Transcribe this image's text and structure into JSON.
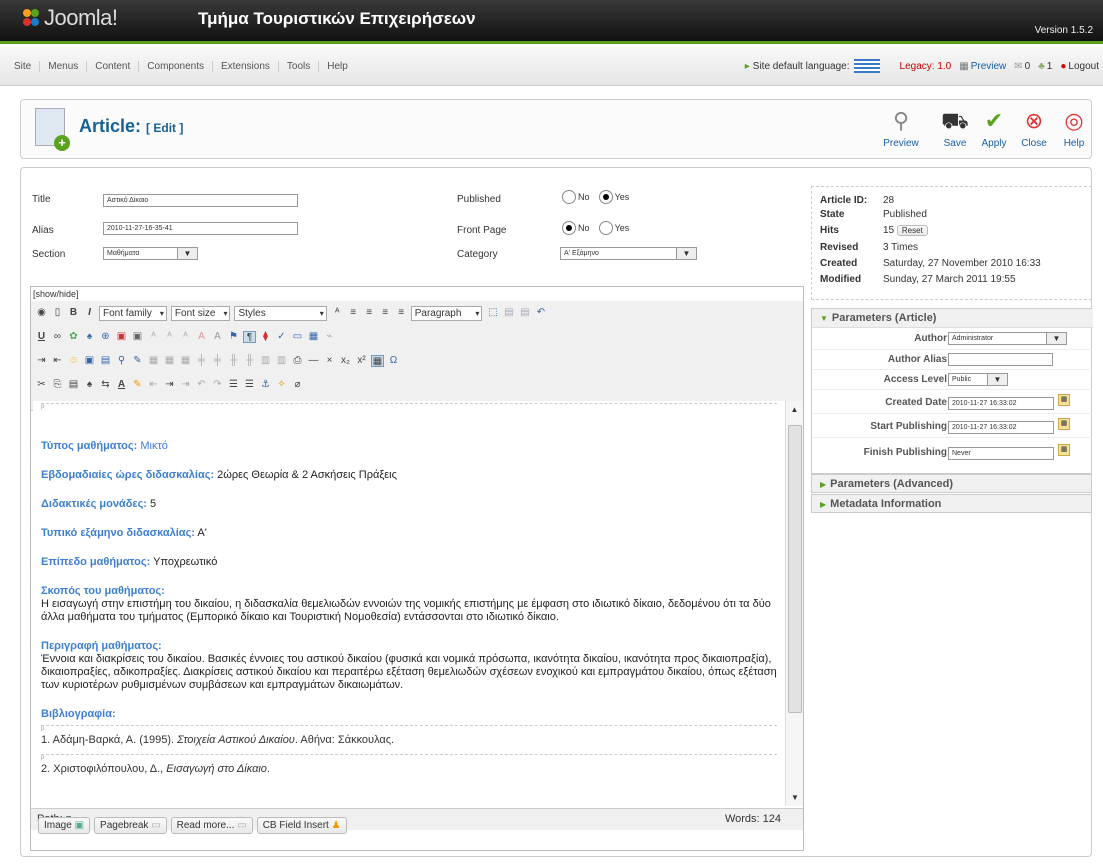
{
  "header": {
    "logo_text": "Joomla!",
    "site_title": "Τμήμα Τουριστικών Επιχειρήσεων",
    "version": "Version 1.5.2"
  },
  "menu": [
    "Site",
    "Menus",
    "Content",
    "Components",
    "Extensions",
    "Tools",
    "Help"
  ],
  "status": {
    "site_default_language": "Site default language:",
    "legacy": "Legacy: 1.0",
    "preview": "Preview",
    "messages": "0",
    "users": "1",
    "logout": "Logout"
  },
  "toolbar": {
    "title": "Article:",
    "subtitle": "[ Edit ]",
    "preview": "Preview",
    "save": "Save",
    "apply": "Apply",
    "close": "Close",
    "help": "Help"
  },
  "form": {
    "title_label": "Title",
    "title_value": "Αστικό Δίκαιο",
    "alias_label": "Alias",
    "alias_value": "2010-11-27-16-35-41",
    "section_label": "Section",
    "section_value": "Μαθήματα",
    "published_label": "Published",
    "front_page_label": "Front Page",
    "category_label": "Category",
    "category_value": "Α' Εξάμηνο",
    "no": "No",
    "yes": "Yes"
  },
  "editor": {
    "showhide": "[show/hide]",
    "font_family": "Font family",
    "font_size": "Font size",
    "styles": "Styles",
    "paragraph": "Paragraph",
    "p_marker": "p",
    "lines": [
      {
        "k": "Τύπος μαθήματος:",
        "v": " Μικτό"
      },
      {
        "k": "Εβδομαδιαίες ώρες διδασκαλίας:",
        "v": " 2ώρες Θεωρία & 2 Ασκήσεις Πράξεις"
      },
      {
        "k": "Διδακτικές μονάδες:",
        "v": " 5"
      },
      {
        "k": "Τυπικό εξάμηνο διδασκαλίας:",
        "v": " Α'"
      },
      {
        "k": "Επίπεδο μαθήματος:",
        "v": " Υποχρεωτικό"
      }
    ],
    "goal_heading": "Σκοπός του μαθήματος:",
    "goal_text": "Η εισαγωγή στην επιστήμη του δικαίου, η διδασκαλία θεμελιωδών εννοιών της νομικής επιστήμης με έμφαση στο ιδιωτικό δίκαιο, δεδομένου ότι τα δύο άλλα μαθήματα του τμήματος (Εμπορικό δίκαιο και Τουριστική Νομοθεσία) εντάσσονται στο ιδιωτικό δίκαιο.",
    "desc_heading": "Περιγραφή μαθήματος:",
    "desc_text": "Έννοια και διακρίσεις του δικαίου. Βασικές έννοιες του αστικού δικαίου (φυσικά και νομικά πρόσωπα, ικανότητα δικαίου, ικανότητα προς δικαιοπραξία), δικαιοπραξίες, αδικοπραξίες. Διακρίσεις αστικού δικαίου και περαιτέρω εξέταση θεμελιωδών σχέσεων ενοχικού και εμπραγμάτου δικαίου, όπως εξέταση των κυριοτέρων ρυθμισμένων συμβάσεων και εμπραγμάτων δικαιωμάτων.",
    "bib_heading": "Βιβλιογραφία:",
    "bib1_pre": "1. Αδάμη-Βαρκά, Α. (1995). ",
    "bib1_it": "Στοιχεία Αστικού Δικαίου",
    "bib1_post": ". Αθήνα: Σάκκουλας.",
    "bib2_pre": "2. Χριστοφιλόπουλου, Δ., ",
    "bib2_it": "Εισαγωγή στο Δίκαιο",
    "bib2_post": ".",
    "path": "Path: p",
    "words": "Words: 124"
  },
  "buttons": {
    "image": "Image",
    "pagebreak": "Pagebreak",
    "readmore": "Read more...",
    "cbfield": "CB Field Insert"
  },
  "info": {
    "article_id_label": "Article ID:",
    "article_id": "28",
    "state_label": "State",
    "state": "Published",
    "hits_label": "Hits",
    "hits": "15",
    "reset": "Reset",
    "revised_label": "Revised",
    "revised": "3 Times",
    "created_label": "Created",
    "created": "Saturday, 27 November 2010 16:33",
    "modified_label": "Modified",
    "modified": "Sunday, 27 March 2011 19:55"
  },
  "params": {
    "header": "Parameters (Article)",
    "author_label": "Author",
    "author_value": "Administrator",
    "alias_label": "Author Alias",
    "alias_value": "",
    "access_label": "Access Level",
    "access_value": "Public",
    "created_label": "Created Date",
    "created_value": "2010-11-27 16:33:02",
    "start_label": "Start Publishing",
    "start_value": "2010-11-27 16:33:02",
    "finish_label": "Finish Publishing",
    "finish_value": "Never",
    "advanced": "Parameters (Advanced)",
    "metadata": "Metadata Information"
  }
}
